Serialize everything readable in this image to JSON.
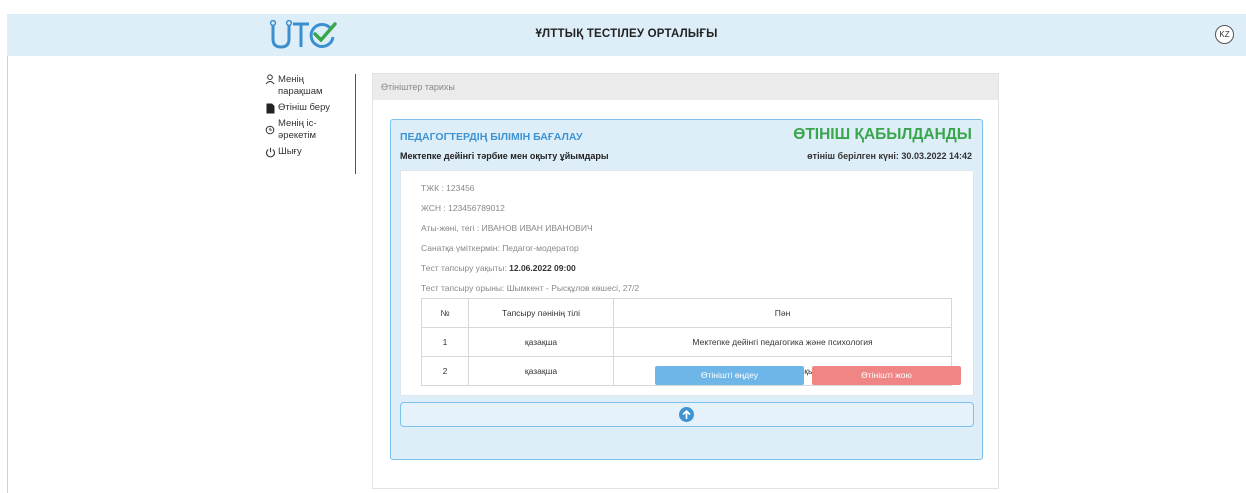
{
  "header": {
    "title": "ҰЛТТЫҚ ТЕСТІЛЕУ ОРТАЛЫҒЫ",
    "lang": "KZ",
    "logo_color": "#3a8fce",
    "logo_check_color": "#3aa64c"
  },
  "sidebar": {
    "items": [
      {
        "label_line1": "Менің",
        "label_line2": "парақшам",
        "icon": "user-icon"
      },
      {
        "label": "Өтініш беру",
        "icon": "document-icon"
      },
      {
        "label_line1": "Менің іс-",
        "label_line2": "әрекетім",
        "icon": "history-icon"
      },
      {
        "label": "Шығу",
        "icon": "power-icon"
      }
    ]
  },
  "panel": {
    "heading": "Өтініштер тарихы"
  },
  "application": {
    "title": "ПЕДАГОГТЕРДІҢ БІЛІМІН БАҒАЛАУ",
    "status": "ӨТІНІШ ҚАБЫЛДАНДЫ",
    "organization": "Мектепке дейінгі тәрбие мен оқыту ұйымдары",
    "submitted": "өтініш берілген күні: 30.03.2022 14:42",
    "info": {
      "tzhk": "ТЖК : 123456",
      "zhsn": "ЖСН : 123456789012",
      "fullname": "Аты-жөні, тегі : ИВАНОВ ИВАН ИВАНОВИЧ",
      "category": "Санатқа үміткермін: Педагог-модератор",
      "test_time_label": "Тест тапсыру уақыты: ",
      "test_time_value": "12.06.2022 09:00",
      "test_place": "Тест тапсыру орыны: Шымкент - Рысқұлов көшесі, 27/2"
    },
    "table": {
      "headers": [
        "№",
        "Тапсыру пәнінің тілі",
        "Пән"
      ],
      "rows": [
        [
          "1",
          "қазақша",
          "Мектепке дейінгі педагогика және психология"
        ],
        [
          "2",
          "қазақша",
          "Мектепке дейінгі тәрбие мен оқытудың әдістемесі"
        ]
      ]
    },
    "buttons": {
      "edit": "Өтінішті өңдеу",
      "delete": "Өтінішті жою"
    }
  },
  "colors": {
    "accent_blue": "#3f93d2",
    "status_green": "#3aa64c",
    "delete_red": "#f08585",
    "edit_blue": "#6fb6e8"
  }
}
